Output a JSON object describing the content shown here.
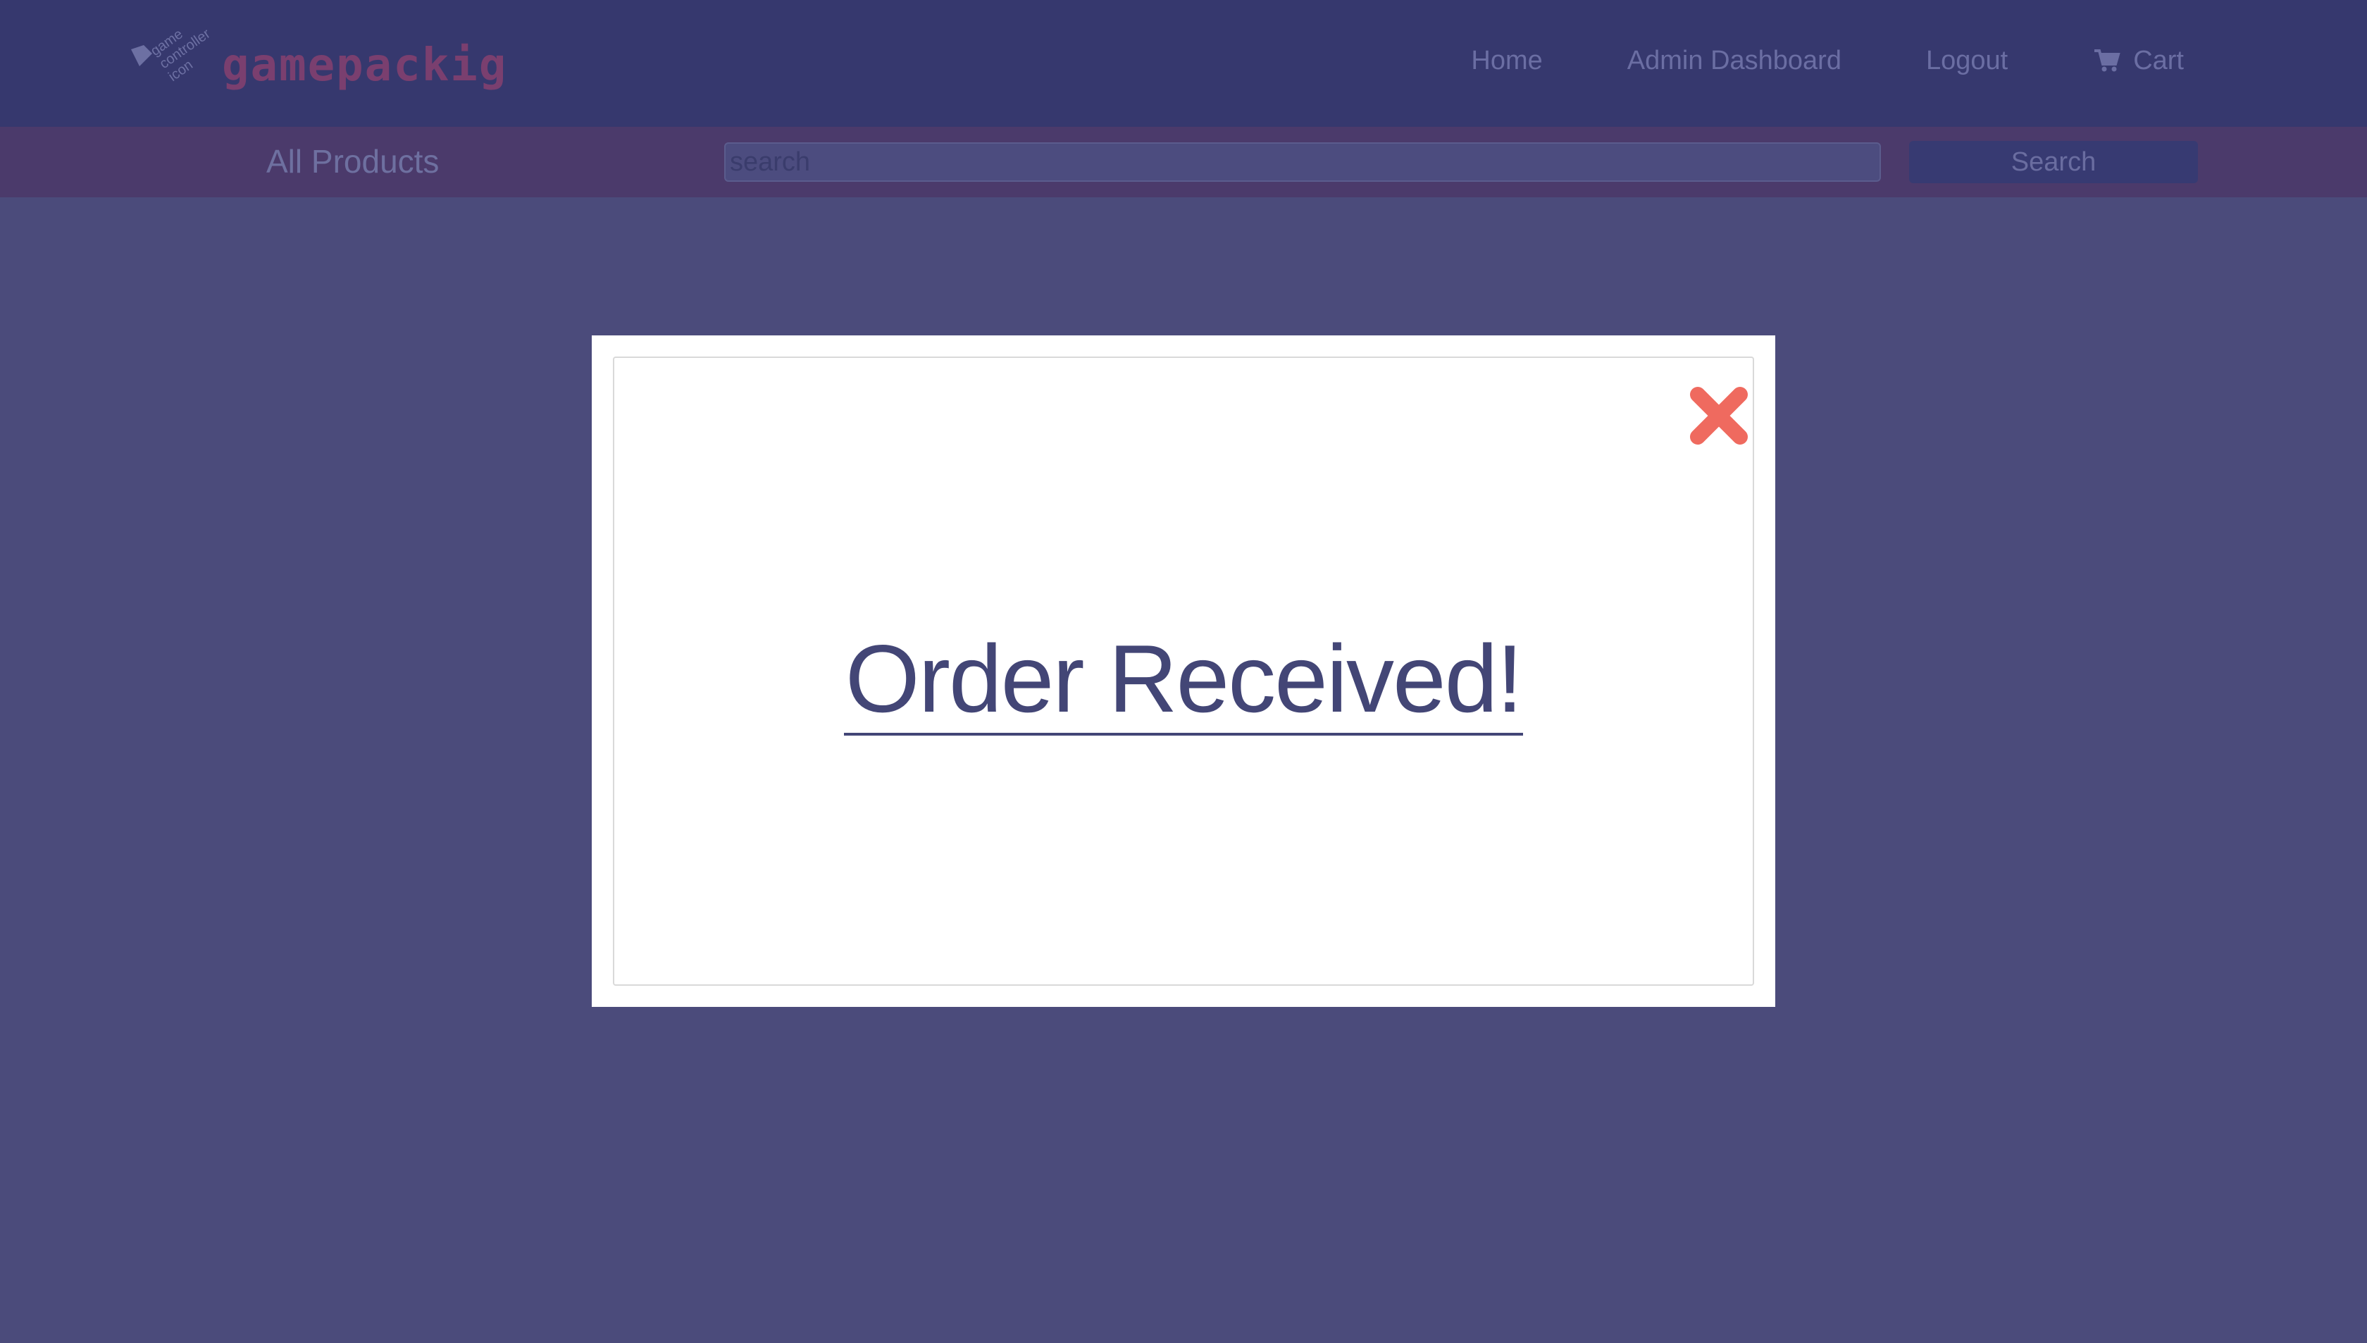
{
  "navbar": {
    "logo_alt": "game controller icon",
    "logo_text": "gamepackig",
    "links": [
      {
        "label": "Home"
      },
      {
        "label": "Admin Dashboard"
      },
      {
        "label": "Logout"
      },
      {
        "label": "Cart",
        "icon": "cart-icon"
      }
    ]
  },
  "subbar": {
    "title": "All Products",
    "search": {
      "placeholder": "search",
      "value": ""
    },
    "search_button": "Search"
  },
  "modal": {
    "title": "Order Received!",
    "close_icon": "close-icon"
  },
  "colors": {
    "background": "#4b4b7b",
    "navbar": "#36386e",
    "subbar": "#4b3a6b",
    "modal_title": "#434676",
    "close_icon": "#ef6a5f"
  }
}
